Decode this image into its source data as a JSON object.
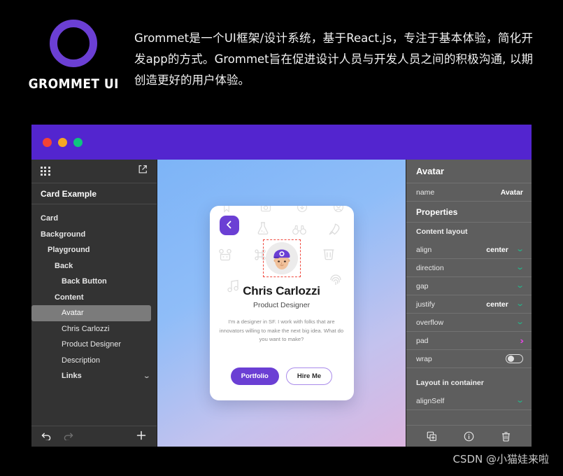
{
  "banner": {
    "logo_word": "GROMMET UI",
    "logo_icon": "grommet-ring-logo",
    "description": "Grommet是一个UI框架/设计系统，基于React.js，专注于基本体验，简化开发app的方式。Grommet旨在促进设计人员与开发人员之间的积极沟通, 以期创造更好的用户体验。"
  },
  "window": {
    "traffic_lights": [
      "close",
      "minimize",
      "maximize"
    ],
    "titlebar_color": "#5325cf"
  },
  "sidebar": {
    "apps_icon": "grid-apps-icon",
    "external_icon": "external-link-icon",
    "title": "Card Example",
    "tree": [
      {
        "label": "Card",
        "depth": 0,
        "bold": true,
        "selected": false,
        "chevron": false
      },
      {
        "label": "Background",
        "depth": 0,
        "bold": true,
        "selected": false,
        "chevron": false
      },
      {
        "label": "Playground",
        "depth": 1,
        "bold": true,
        "selected": false,
        "chevron": false
      },
      {
        "label": "Back",
        "depth": 2,
        "bold": true,
        "selected": false,
        "chevron": false
      },
      {
        "label": "Back Button",
        "depth": 3,
        "bold": true,
        "selected": false,
        "chevron": false
      },
      {
        "label": "Content",
        "depth": 2,
        "bold": true,
        "selected": false,
        "chevron": false
      },
      {
        "label": "Avatar",
        "depth": 3,
        "bold": false,
        "selected": true,
        "chevron": false
      },
      {
        "label": "Chris Carlozzi",
        "depth": 3,
        "bold": false,
        "selected": false,
        "chevron": false
      },
      {
        "label": "Product Designer",
        "depth": 3,
        "bold": false,
        "selected": false,
        "chevron": false
      },
      {
        "label": "Description",
        "depth": 3,
        "bold": false,
        "selected": false,
        "chevron": false
      },
      {
        "label": "Links",
        "depth": 3,
        "bold": true,
        "selected": false,
        "chevron": true
      }
    ],
    "bottom": {
      "undo_icon": "undo-arrow-icon",
      "redo_icon": "redo-arrow-icon",
      "add_icon": "plus-icon"
    }
  },
  "card": {
    "back_icon": "chevron-left-icon",
    "avatar_icon": "user-avatar-with-cap",
    "avatar_selected": true,
    "name": "Chris Carlozzi",
    "role": "Product Designer",
    "description": "I'm a designer in SF. I work with folks that are innovators willing to make the next big idea. What do you want to make?",
    "primary_button": "Portfolio",
    "secondary_button": "Hire Me",
    "accent_color": "#6b3fd4",
    "selection_color": "#f0483e",
    "background_icons": [
      "bookmark-icon",
      "camera-icon",
      "download-circle-icon",
      "user-circle-icon",
      "flask-icon",
      "binoculars-icon",
      "rocket-icon",
      "bear-icon",
      "command-icon",
      "trash-icon",
      "music-note-icon",
      "fingerprint-icon"
    ]
  },
  "properties": {
    "header": "Avatar",
    "name_row": {
      "key": "name",
      "value": "Avatar"
    },
    "section_title": "Properties",
    "content_layout_label": "Content layout",
    "rows": [
      {
        "key": "align",
        "value": "center",
        "control": "chevron-down-icon",
        "control_color": "#1fbf8f"
      },
      {
        "key": "direction",
        "value": "",
        "control": "chevron-down-icon",
        "control_color": "#1fbf8f"
      },
      {
        "key": "gap",
        "value": "",
        "control": "chevron-down-icon",
        "control_color": "#1fbf8f"
      },
      {
        "key": "justify",
        "value": "center",
        "control": "chevron-down-icon",
        "control_color": "#1fbf8f"
      },
      {
        "key": "overflow",
        "value": "",
        "control": "chevron-down-icon",
        "control_color": "#1fbf8f"
      },
      {
        "key": "pad",
        "value": "",
        "control": "chevron-right-icon",
        "control_color": "#d948d9"
      },
      {
        "key": "wrap",
        "value": "",
        "control": "toggle-switch",
        "control_color": "#e2e2e2"
      }
    ],
    "layout_in_container_label": "Layout in container",
    "container_rows": [
      {
        "key": "alignSelf",
        "value": "",
        "control": "chevron-down-icon",
        "control_color": "#1fbf8f"
      }
    ],
    "bottom": {
      "duplicate_icon": "duplicate-add-icon",
      "info_icon": "info-circle-icon",
      "delete_icon": "trash-icon"
    }
  },
  "watermark": "CSDN @小猫娃来啦"
}
